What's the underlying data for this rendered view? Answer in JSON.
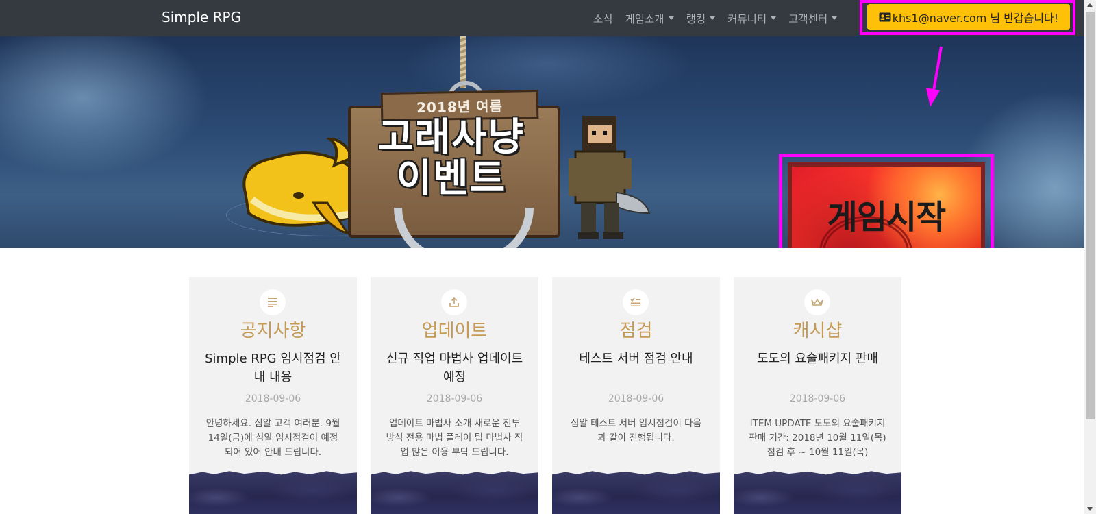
{
  "navbar": {
    "brand": "Simple RPG",
    "items": [
      {
        "label": "소식",
        "dropdown": false
      },
      {
        "label": "게임소개",
        "dropdown": true
      },
      {
        "label": "랭킹",
        "dropdown": true
      },
      {
        "label": "커뮤니티",
        "dropdown": true
      },
      {
        "label": "고객센터",
        "dropdown": true
      }
    ],
    "user_button": "khs1@naver.com 님 반갑습니다!",
    "user_icon": "id-card-icon"
  },
  "hero": {
    "event_subtitle": "2018년 여름",
    "event_title": "고래사냥 이벤트",
    "event_title_line1": "고래사냥",
    "event_title_line2": "이벤트",
    "start_button": "게임시작"
  },
  "cards": [
    {
      "icon": "list-icon",
      "category": "공지사항",
      "title": "Simple RPG 임시점검 안내 내용",
      "date": "2018-09-06",
      "body": "안녕하세요. 심알 고객 여러분. 9월 14일(금)에 심알 임시점검이 예정되어 있어 안내 드립니다."
    },
    {
      "icon": "upload-icon",
      "category": "업데이트",
      "title": "신규 직업 마법사 업데이트 예정",
      "date": "2018-09-06",
      "body": "업데이트 마법사 소개 새로운 전투 방식 전용 마법 플레이 팁 마법사 직업 많은 이용 부탁 드립니다."
    },
    {
      "icon": "checklist-icon",
      "category": "점검",
      "title": "테스트 서버 점검 안내",
      "date": "2018-09-06",
      "body": "심알 테스트 서버 임시점검이 다음과 같이 진행됩니다."
    },
    {
      "icon": "crown-icon",
      "category": "캐시샵",
      "title": "도도의 요술패키지 판매",
      "date": "2018-09-06",
      "body": "ITEM UPDATE 도도의 요술패키지판매 기간: 2018년 10월 11일(목) 점검 후 ~ 10월 11일(목)"
    }
  ],
  "colors": {
    "navbar_bg": "#343a40",
    "user_button_bg": "#ffc107",
    "highlight": "#ff00ff",
    "category_text": "#c49a55",
    "card_bg": "#f2f2f2"
  }
}
